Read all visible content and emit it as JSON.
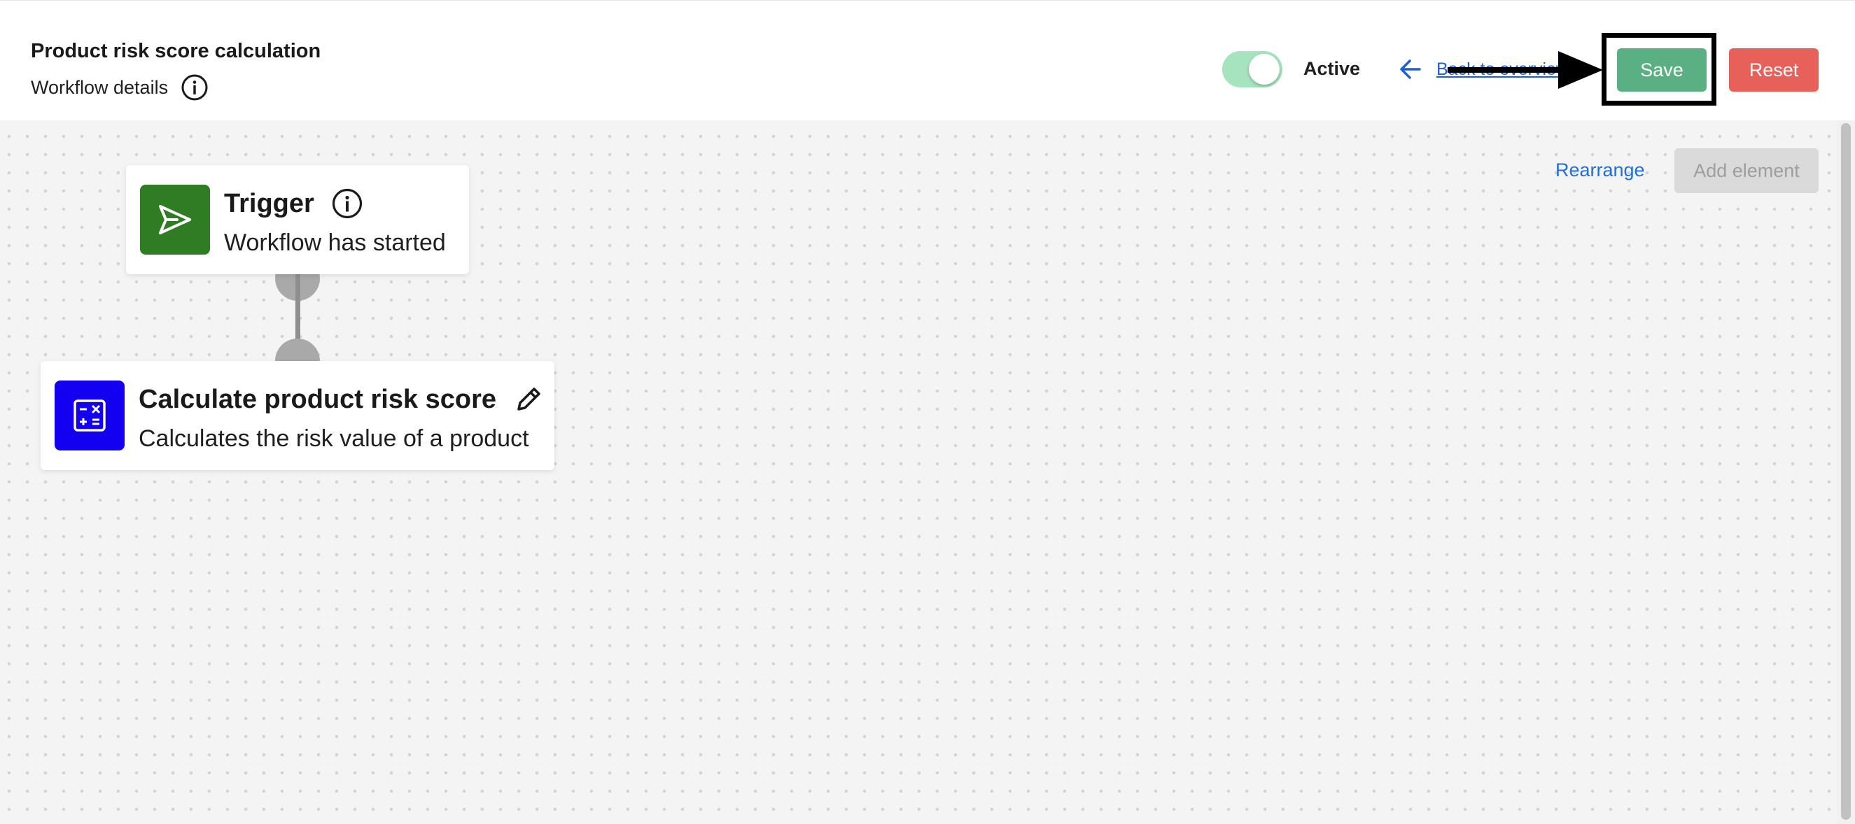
{
  "header": {
    "title": "Product risk score calculation",
    "subtitle": "Workflow details",
    "status_label": "Active",
    "back_label": "Back to overview",
    "save_label": "Save",
    "reset_label": "Reset"
  },
  "toggle": {
    "on": true,
    "color": "#a6e3bf"
  },
  "toolbar": {
    "rearrange_label": "Rearrange",
    "add_element_label": "Add element"
  },
  "nodes": [
    {
      "title": "Trigger",
      "subtitle": "Workflow has started",
      "icon": "send-icon",
      "icon_color": "#2e7d22",
      "action_icon": "info-icon"
    },
    {
      "title": "Calculate product risk score",
      "subtitle": "Calculates the risk value of a product",
      "icon": "calculator-icon",
      "icon_color": "#1400f0",
      "action_icon": "pencil-icon"
    }
  ],
  "colors": {
    "save": "#5ab083",
    "reset": "#e8605a",
    "link": "#1f6fd6",
    "highlight": "#000000"
  }
}
